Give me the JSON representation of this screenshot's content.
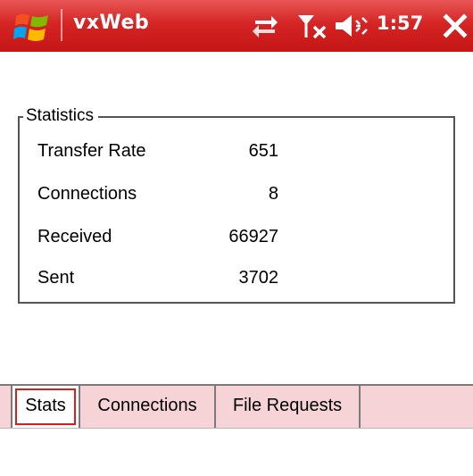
{
  "titlebar": {
    "app_title": "vxWeb",
    "clock": "1:57",
    "icons": {
      "start": "windows-flag-icon",
      "connectivity": "sync-arrows-icon",
      "signal": "no-signal-antenna-icon",
      "volume": "speaker-volume-icon",
      "close": "close-icon"
    },
    "colors": {
      "bar": "#d52424",
      "text": "#ffffff"
    }
  },
  "statistics": {
    "legend": "Statistics",
    "rows": [
      {
        "label": "Transfer Rate",
        "value": "651"
      },
      {
        "label": "Connections",
        "value": "8"
      },
      {
        "label": "Received",
        "value": "66927"
      },
      {
        "label": "Sent",
        "value": "3702"
      }
    ]
  },
  "tabs": {
    "items": [
      {
        "label": "Stats",
        "active": true
      },
      {
        "label": "Connections",
        "active": false
      },
      {
        "label": "File Requests",
        "active": false
      }
    ],
    "colors": {
      "strip": "#f6d3d6",
      "active_focus": "#d81e1e"
    }
  }
}
